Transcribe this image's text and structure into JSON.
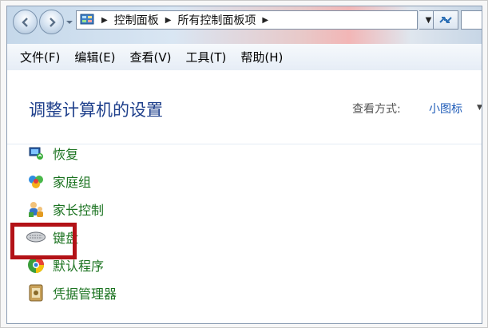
{
  "address_bar": {
    "crumbs": [
      "控制面板",
      "所有控制面板项"
    ]
  },
  "menu": {
    "items": [
      "文件(F)",
      "编辑(E)",
      "查看(V)",
      "工具(T)",
      "帮助(H)"
    ]
  },
  "header": {
    "title": "调整计算机的设置",
    "view_by_label": "查看方式:",
    "view_by_value": "小图标"
  },
  "items": [
    {
      "label": "恢复",
      "icon": "recovery-icon"
    },
    {
      "label": "家庭组",
      "icon": "homegroup-icon"
    },
    {
      "label": "家长控制",
      "icon": "parental-controls-icon"
    },
    {
      "label": "键盘",
      "icon": "keyboard-icon"
    },
    {
      "label": "默认程序",
      "icon": "default-programs-icon"
    },
    {
      "label": "凭据管理器",
      "icon": "credential-manager-icon"
    }
  ],
  "colors": {
    "highlight": "#b31217",
    "link_green": "#1b7320",
    "title_blue": "#1e3f8b"
  }
}
